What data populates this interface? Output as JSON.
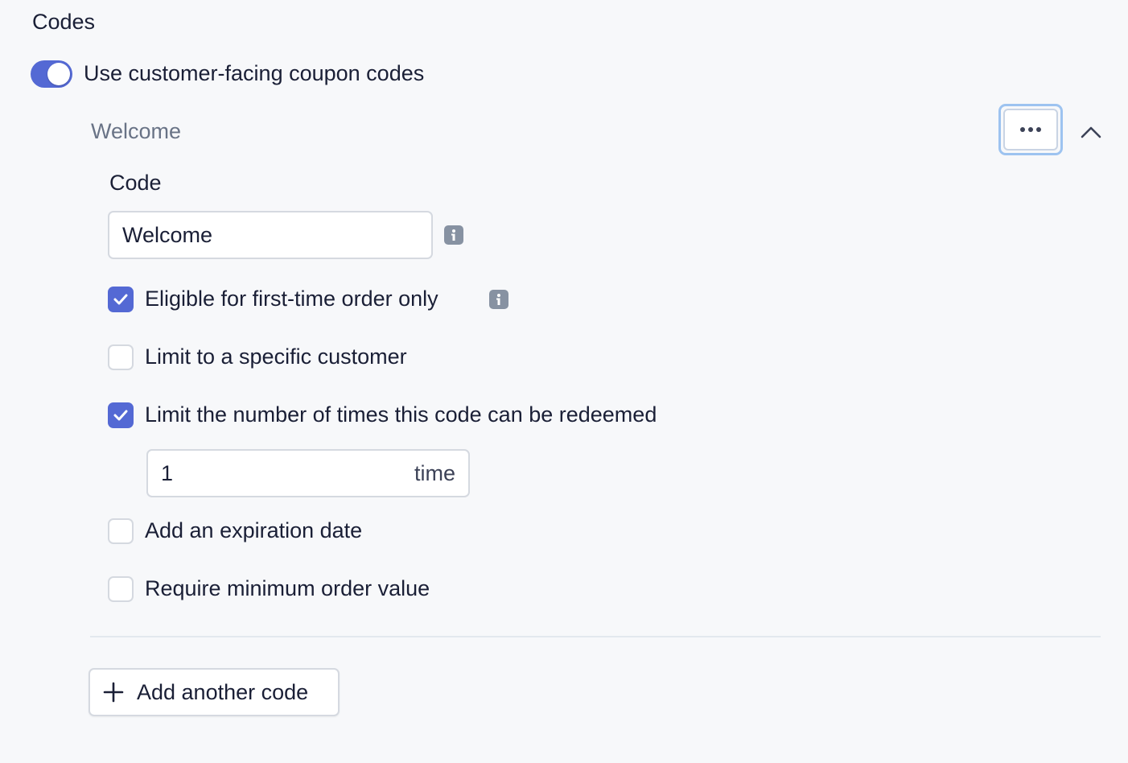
{
  "section": {
    "title": "Codes"
  },
  "toggle": {
    "label": "Use customer-facing coupon codes",
    "on": true
  },
  "code_item": {
    "header_name": "Welcome",
    "code_label": "Code",
    "code_value": "Welcome",
    "options": [
      {
        "label": "Eligible for first-time order only",
        "checked": true,
        "has_info": true
      },
      {
        "label": "Limit to a specific customer",
        "checked": false,
        "has_info": false
      },
      {
        "label": "Limit the number of times this code can be redeemed",
        "checked": true,
        "has_info": false
      },
      {
        "label": "Add an expiration date",
        "checked": false,
        "has_info": false
      },
      {
        "label": "Require minimum order value",
        "checked": false,
        "has_info": false
      }
    ],
    "redemption_limit": {
      "value": "1",
      "unit": "time"
    }
  },
  "add_button": {
    "label": "Add another code"
  },
  "colors": {
    "accent": "#5469d4",
    "focus_ring": "#9dc3f0",
    "muted_text": "#697386",
    "info_icon": "#8792a2"
  },
  "icons": {
    "more": "more-horizontal-icon",
    "collapse": "chevron-up-icon",
    "info": "info-icon",
    "check": "check-icon",
    "add": "plus-icon"
  }
}
